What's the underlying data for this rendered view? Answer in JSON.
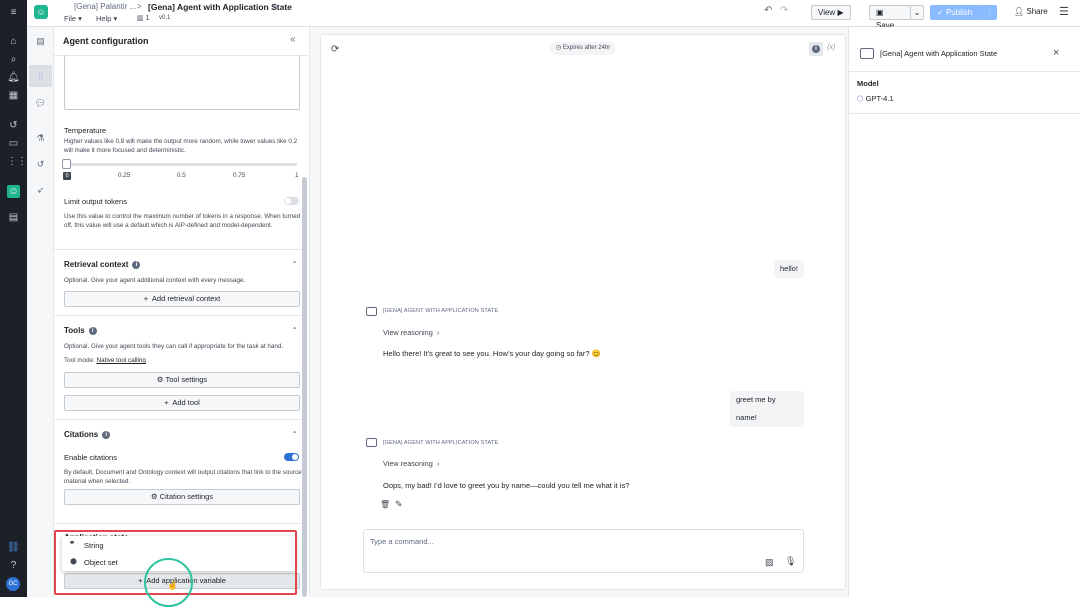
{
  "rail_icons": [
    "menu-icon",
    "home-icon",
    "search-icon",
    "notifications-icon",
    "apps-icon",
    "history-icon",
    "folder-icon",
    "grid-icon",
    "agent-icon",
    "files-icon",
    "link-icon",
    "help-icon"
  ],
  "user_initials": "GC",
  "header": {
    "breadcrumb_parent": "[Gena] Palantir ...",
    "breadcrumb_sep": ">",
    "title": "[Gena] Agent with Application State",
    "star": "☆",
    "menu_file": "File",
    "menu_help": "Help",
    "version_count": "1",
    "version": "v0.1",
    "view_label": "View",
    "save_label": "Save",
    "publish_label": "Publish",
    "share_label": "Share"
  },
  "config": {
    "title": "Agent configuration",
    "temperature_label": "Temperature",
    "temperature_help": "Higher values like 0.8 will make the output more random, while lower values like 0.2 will make it more focused and deterministic.",
    "temperature_value": 0,
    "slider_ticks": [
      "0",
      "0.25",
      "0.5",
      "0.75",
      "1"
    ],
    "limit_tokens_label": "Limit output tokens",
    "limit_tokens_help": "Use this value to control the maximum number of tokens in a response. When turned off, this value will use a default which is AIP-defined and model-dependent.",
    "retrieval_title": "Retrieval context",
    "retrieval_help": "Optional. Give your agent additional context with every message.",
    "retrieval_button": "Add retrieval context",
    "tools_title": "Tools",
    "tools_help": "Optional. Give your agent tools they can call if appropriate for the task at hand.",
    "tool_mode_label": "Tool mode:",
    "tool_mode_value": "Native tool calling",
    "tool_settings_button": "Tool settings",
    "add_tool_button": "Add tool",
    "citations_title": "Citations",
    "enable_citations_label": "Enable citations",
    "citations_help": "By default, Document and Ontology context will output citations that link to the source material when selected.",
    "citation_settings_button": "Citation settings",
    "app_vars_title": "Application state",
    "add_app_var_button": "Add application variable"
  },
  "menu": {
    "items": [
      {
        "label": "String",
        "icon": "quote-icon"
      },
      {
        "label": "Object set",
        "icon": "cube-icon"
      }
    ]
  },
  "chat": {
    "expires": "Expires after 24hr",
    "variables_label": "{x}",
    "messages": [
      {
        "role": "user",
        "text": "hello!"
      },
      {
        "role": "agent",
        "name": "[GENA] AGENT WITH APPLICATION STATE",
        "reasoning": "View reasoning",
        "text": "Hello there! It’s great to see you. How’s your day going so far? 😊"
      },
      {
        "role": "user",
        "text": "greet me by name!"
      },
      {
        "role": "agent",
        "name": "[GENA] AGENT WITH APPLICATION STATE",
        "reasoning": "View reasoning",
        "text": "Oops, my bad! I’d love to greet you by name—could you tell me what it is?"
      }
    ],
    "input_placeholder": "Type a command..."
  },
  "right_panel": {
    "title": "[Gena] Agent with Application State",
    "model_label": "Model",
    "model_value": "GPT-4.1"
  },
  "colors": {
    "accent": "#2d72d2",
    "brand": "#1fb58f",
    "highlight": "#e0464e"
  }
}
